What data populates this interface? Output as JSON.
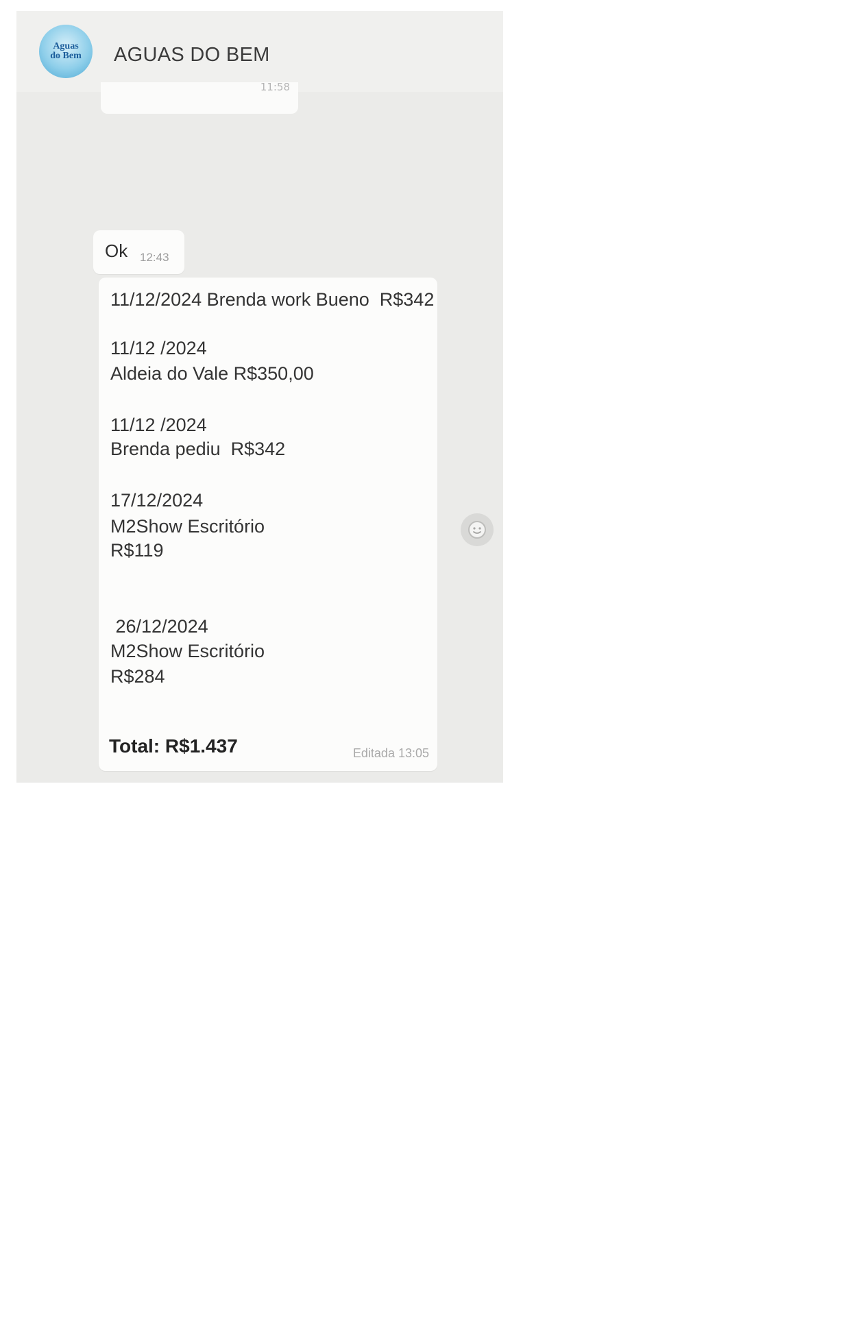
{
  "header": {
    "title": "AGUAS DO BEM",
    "avatar_text": "Aguas\ndo Bem"
  },
  "previous_message": {
    "time": "11:58"
  },
  "messages": [
    {
      "text": "Ok",
      "time": "12:43"
    },
    {
      "lines": [
        "11/12/2024 Brenda work Bueno  R$342",
        "11/12 /2024",
        "Aldeia do Vale R$350,00",
        "11/12 /2024",
        "Brenda pediu  R$342",
        "17/12/2024",
        "M2Show Escritório",
        "R$119",
        " 26/12/2024",
        "M2Show Escritório",
        "R$284"
      ],
      "total": "Total: R$1.437",
      "status_time": "Editada 13:05"
    }
  ],
  "icons": {
    "emoji_button": "smiley-icon"
  },
  "colors": {
    "chat_background": "#ebebe9",
    "bubble": "#fcfcfb",
    "avatar_accent": "#4ca8d4"
  }
}
